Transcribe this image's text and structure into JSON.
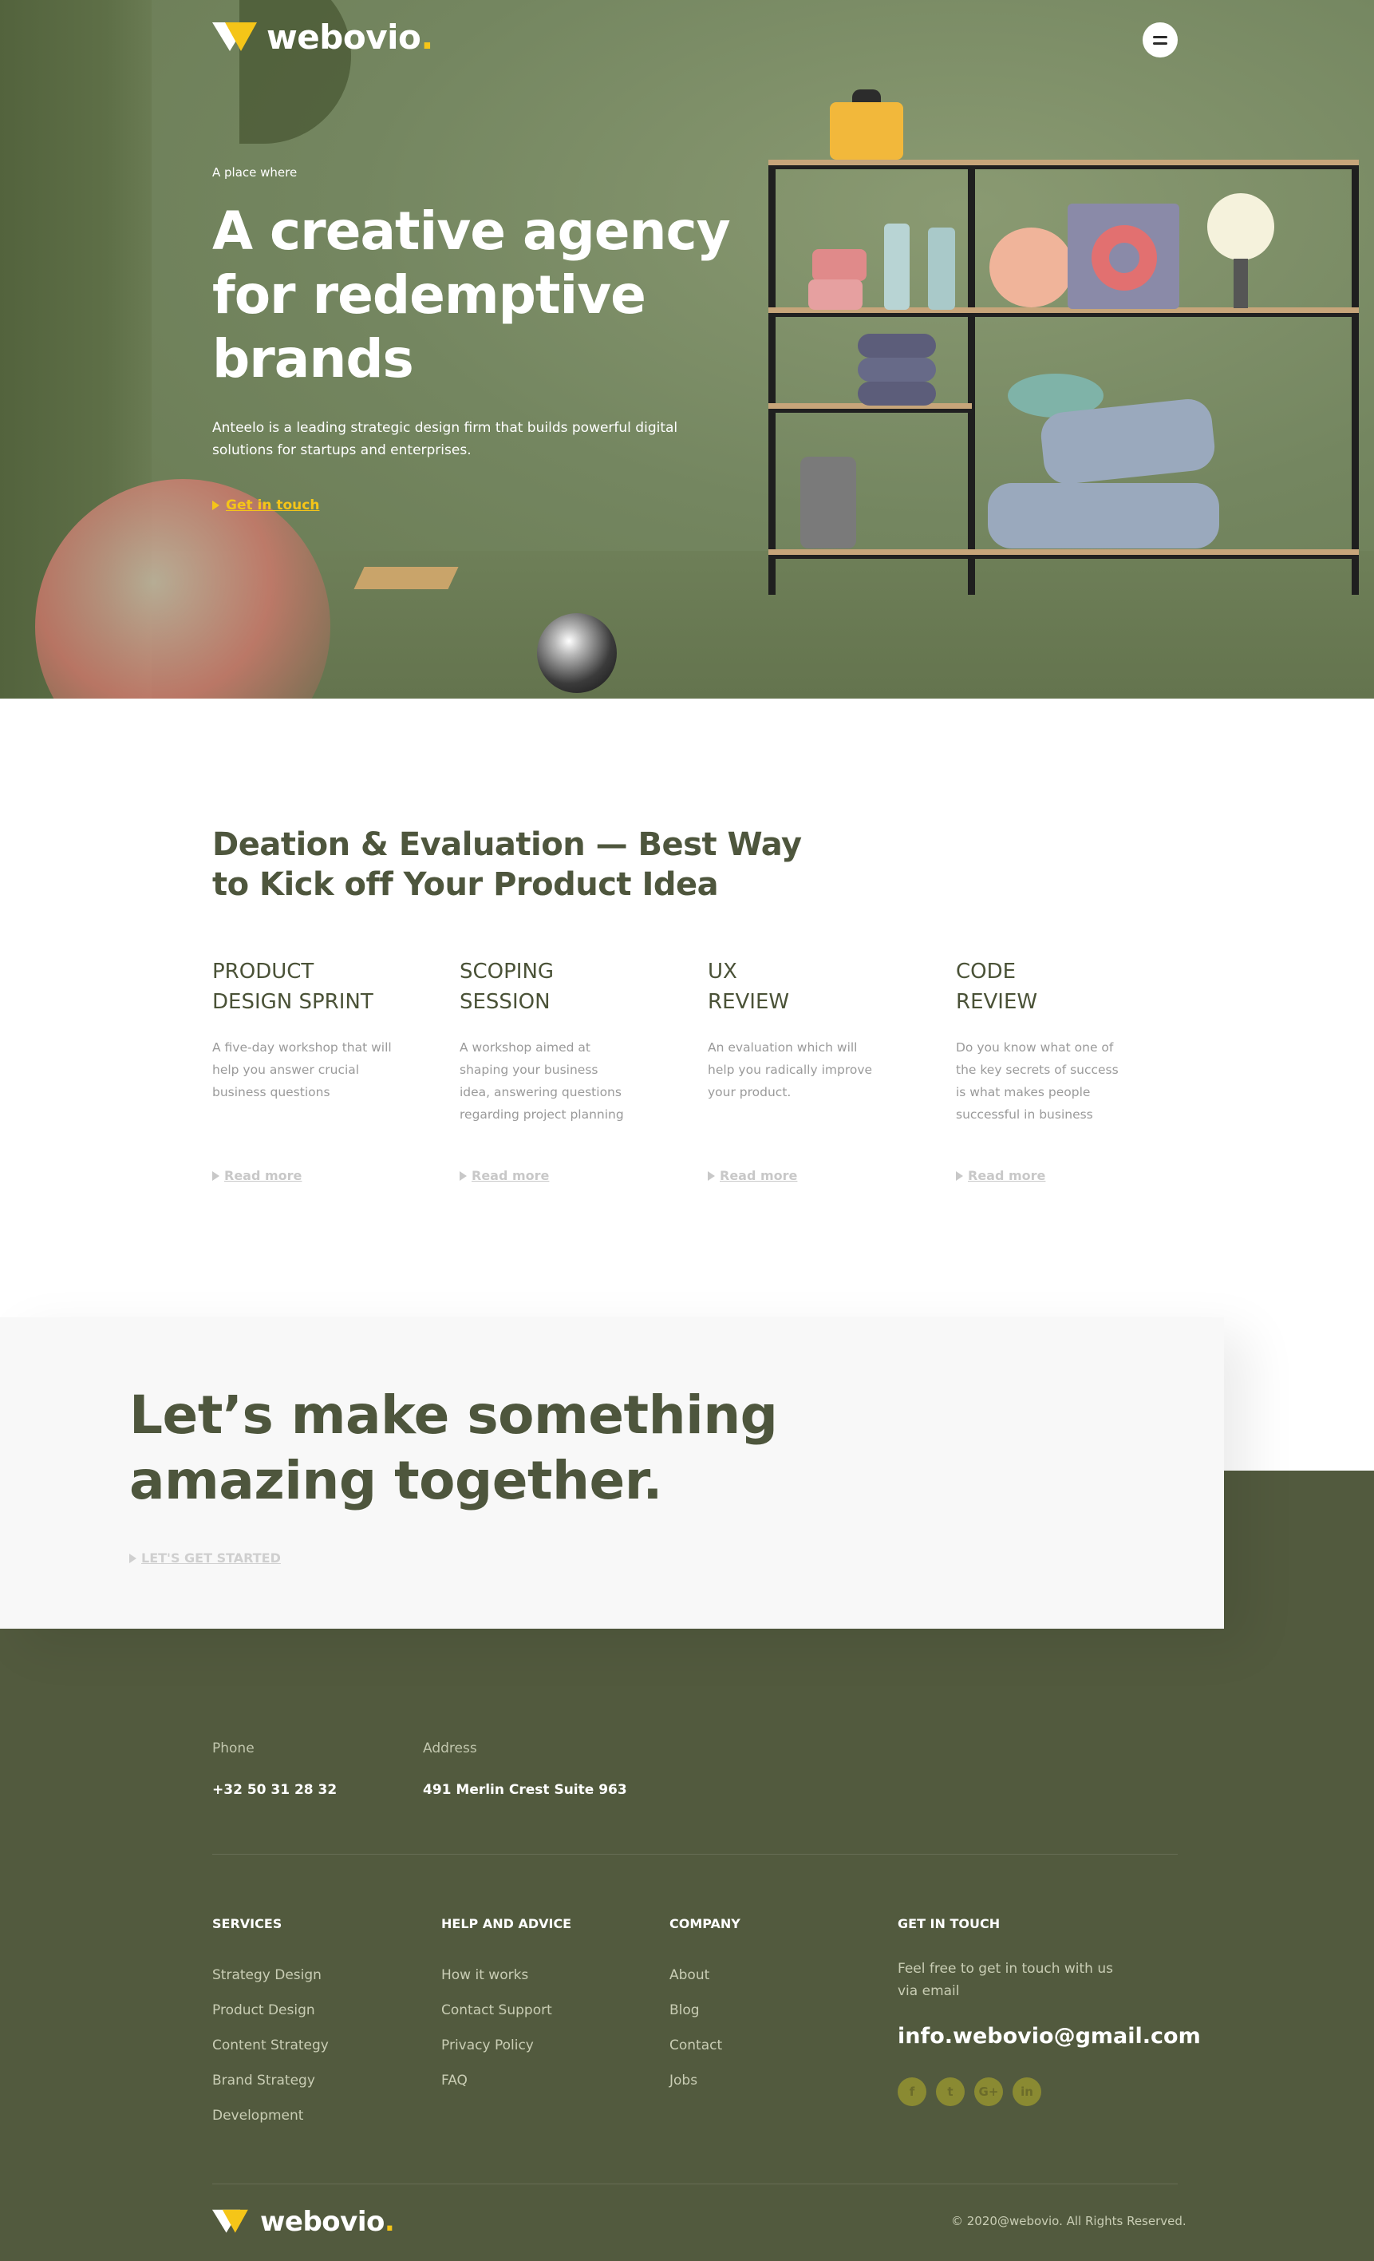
{
  "brand": {
    "name": "webovio",
    "dot": "."
  },
  "hero": {
    "eyebrow": "A place where",
    "title": "A creative agency for redemptive brands",
    "description": "Anteelo is a leading strategic design firm that builds powerful digital solutions for startups and enterprises.",
    "cta": "Get in touch"
  },
  "features": {
    "title": "Deation & Evaluation — Best Way to Kick off Your Product Idea",
    "cards": [
      {
        "title_line1": "PRODUCT",
        "title_line2": "DESIGN SPRINT",
        "text": "A five-day workshop that will help you answer crucial business questions",
        "link": "Read more"
      },
      {
        "title_line1": "SCOPING",
        "title_line2": "SESSION",
        "text": "A workshop aimed at shaping your business idea, answering questions regarding project planning",
        "link": "Read more"
      },
      {
        "title_line1": "UX",
        "title_line2": "REVIEW",
        "text": "An evaluation which will help you radically improve your product.",
        "link": "Read more"
      },
      {
        "title_line1": "CODE",
        "title_line2": "REVIEW",
        "text": "Do you know what one of the key secrets of success is what makes people successful in business",
        "link": "Read more"
      }
    ]
  },
  "cta": {
    "title": "Let’s make something amazing together.",
    "link": "LET'S GET STARTED"
  },
  "contact": {
    "phone_label": "Phone",
    "phone": "+32 50 31 28 32",
    "address_label": "Address",
    "address": "491 Merlin Crest Suite 963"
  },
  "footer": {
    "services": {
      "title": "SERVICES",
      "items": [
        "Strategy Design",
        "Product Design",
        "Content Strategy",
        "Brand Strategy",
        "Development"
      ]
    },
    "help": {
      "title": "HELP AND ADVICE",
      "items": [
        "How it works",
        "Contact Support",
        "Privacy Policy",
        "FAQ"
      ]
    },
    "company": {
      "title": "COMPANY",
      "items": [
        "About",
        "Blog",
        "Contact",
        "Jobs"
      ]
    },
    "get_in_touch": {
      "title": "GET IN TOUCH",
      "text": "Feel free to get in touch with us via email",
      "email": "info.webovio@gmail.com",
      "socials": [
        {
          "icon": "facebook-icon",
          "glyph": "f"
        },
        {
          "icon": "twitter-icon",
          "glyph": "t"
        },
        {
          "icon": "google-plus-icon",
          "glyph": "G+"
        },
        {
          "icon": "linkedin-icon",
          "glyph": "in"
        }
      ]
    },
    "copyright": "© 2020@webovio. All Rights Reserved."
  },
  "colors": {
    "accent": "#f5c518",
    "olive_dark": "#525a3e",
    "heading": "#4e563d",
    "hero_bg": "#748660"
  }
}
